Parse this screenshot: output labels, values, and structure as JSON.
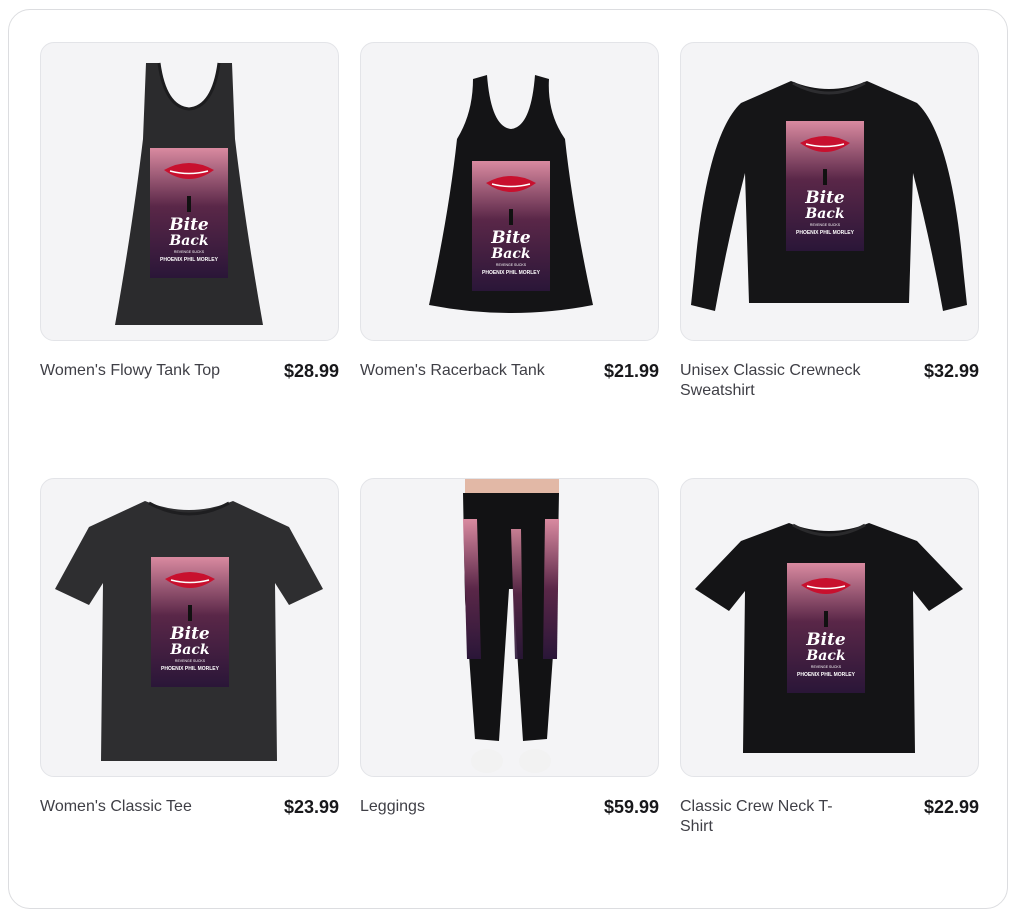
{
  "products": [
    {
      "name": "Women's Flowy Tank Top",
      "price": "$28.99",
      "icon": "flowy-tank-top-image"
    },
    {
      "name": "Women's Racerback Tank",
      "price": "$21.99",
      "icon": "racerback-tank-image"
    },
    {
      "name": "Unisex Classic Crewneck Sweatshirt",
      "price": "$32.99",
      "icon": "crewneck-sweatshirt-image"
    },
    {
      "name": "Women's Classic Tee",
      "price": "$23.99",
      "icon": "classic-tee-image"
    },
    {
      "name": "Leggings",
      "price": "$59.99",
      "icon": "leggings-image"
    },
    {
      "name": "Classic Crew Neck T-Shirt",
      "price": "$22.99",
      "icon": "crew-neck-tshirt-image"
    }
  ],
  "print": {
    "title_line1": "Bite",
    "title_line2": "Back",
    "subtitle": "REVENGE SUCKS",
    "author": "PHOENIX PHIL MORLEY"
  },
  "colors": {
    "garment": "#1c1c1e",
    "background": "#f4f4f6",
    "print_top": "#d98aa0",
    "print_mid": "#5a2748",
    "print_bottom": "#2a1638",
    "accent": "#c8102e"
  }
}
